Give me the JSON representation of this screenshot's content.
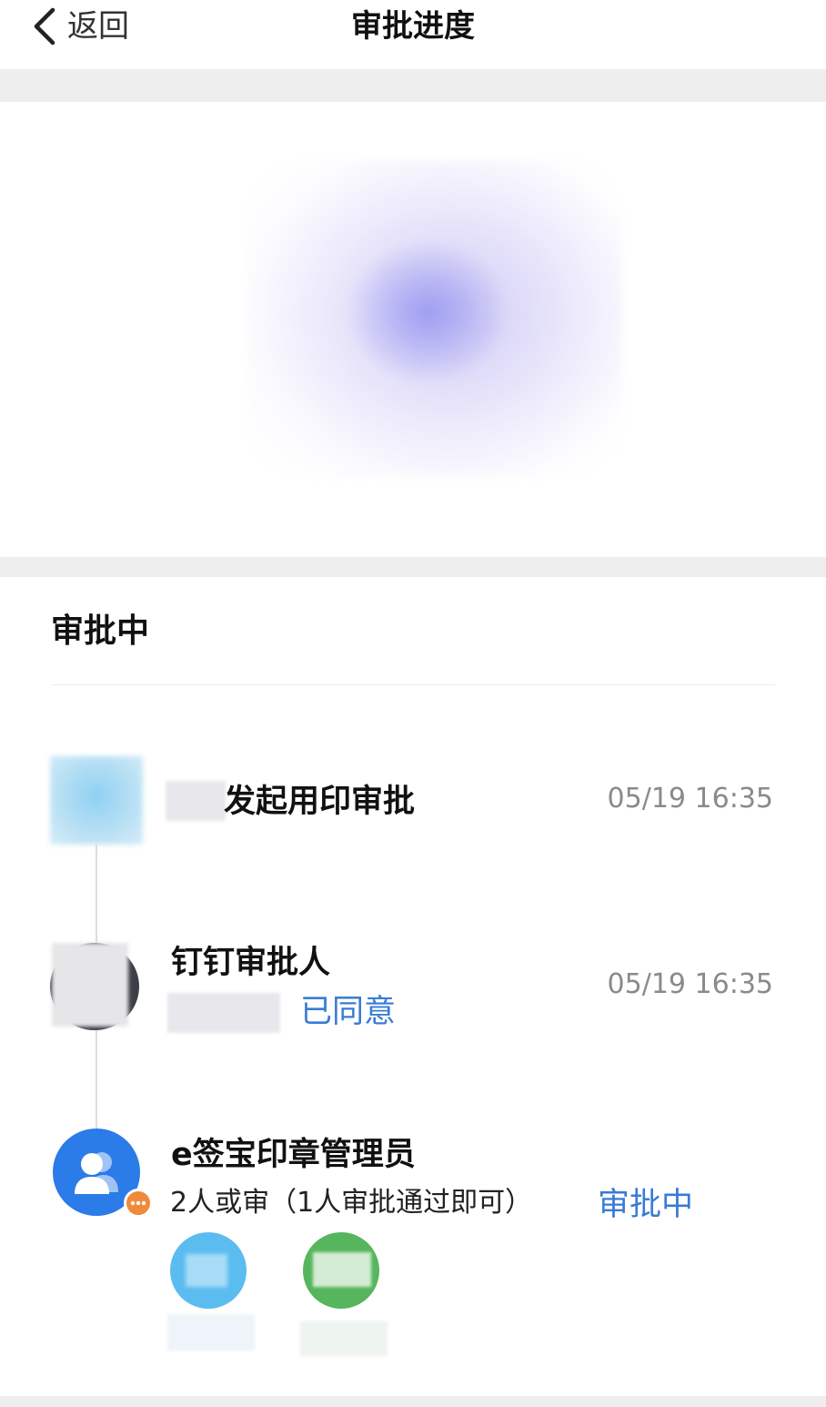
{
  "header": {
    "back_label": "返回",
    "title": "审批进度"
  },
  "progress": {
    "status_heading": "审批中",
    "steps": [
      {
        "title": "发起用印审批",
        "time": "05/19 16:35"
      },
      {
        "title": "钉钉审批人",
        "result": "已同意",
        "time": "05/19 16:35"
      },
      {
        "title": "e签宝印章管理员",
        "rule": "2人或审（1人审批通过即可）",
        "status": "审批中",
        "approvers": [
          {
            "color": "#5bbcf0"
          },
          {
            "color": "#57b55d"
          }
        ]
      }
    ]
  },
  "colors": {
    "accent": "#3a7bd5",
    "avatar_blue": "#2b7be8",
    "pending_badge": "#f08a3a"
  },
  "icons": {
    "back": "chevron-left-icon",
    "group": "user-group-icon",
    "pending": "more-dots-icon"
  }
}
